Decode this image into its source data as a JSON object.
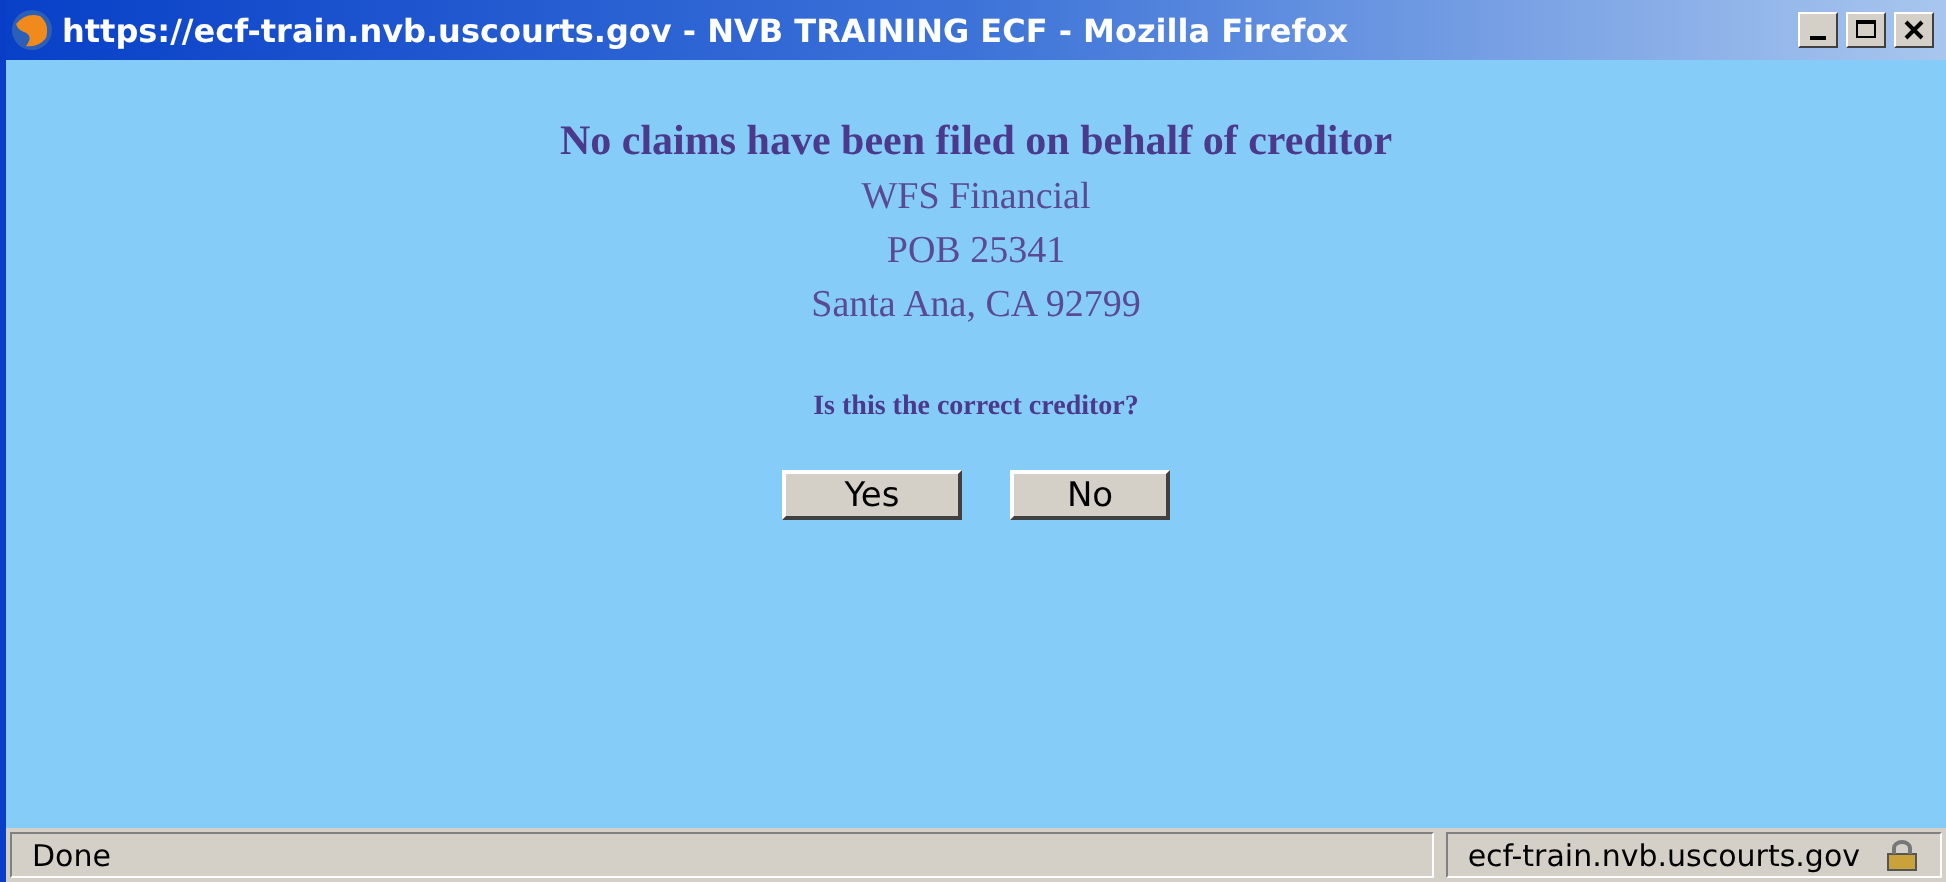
{
  "window": {
    "title": "https://ecf-train.nvb.uscourts.gov - NVB TRAINING ECF - Mozilla Firefox"
  },
  "heading": "No claims have been filed on behalf of creditor",
  "address_lines": [
    "WFS Financial",
    "POB 25341",
    "Santa Ana, CA 92799"
  ],
  "question": "Is this the correct creditor?",
  "buttons": [
    "Yes",
    "No"
  ],
  "status_bar": {
    "status": "Done",
    "host": "ecf-train.nvb.uscourts.gov"
  }
}
